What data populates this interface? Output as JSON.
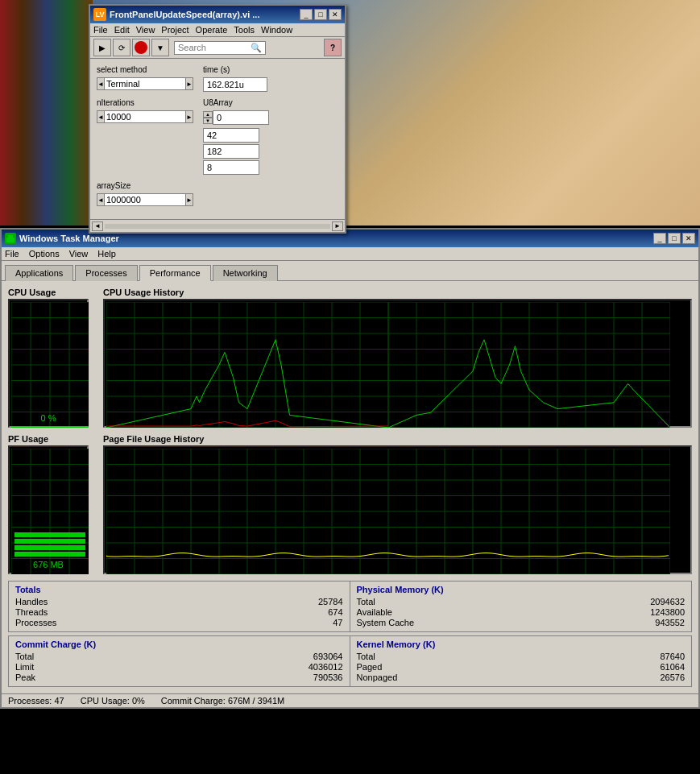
{
  "labview": {
    "title": "FrontPanelUpdateSpeed(array).vi ...",
    "menubar": [
      "File",
      "Edit",
      "View",
      "Project",
      "Operate",
      "Tools",
      "Window"
    ],
    "search_placeholder": "Search",
    "fields": {
      "select_method_label": "select method",
      "select_method_value": "Terminal",
      "time_label": "time (s)",
      "time_value": "162.821u",
      "niterations_label": "nIterations",
      "niterations_value": "10000",
      "arraysize_label": "arraySize",
      "arraysize_value": "1000000",
      "u8array_label": "U8Array",
      "spinner_value": "0",
      "u8array_values": [
        "42",
        "182",
        "8"
      ]
    }
  },
  "taskmanager": {
    "title": "Windows Task Manager",
    "menubar": [
      "File",
      "Options",
      "View",
      "Help"
    ],
    "tabs": [
      "Applications",
      "Processes",
      "Performance",
      "Networking"
    ],
    "active_tab": "Performance",
    "performance": {
      "cpu_usage_label": "CPU Usage",
      "cpu_usage_percent": "0 %",
      "cpu_history_label": "CPU Usage History",
      "pf_usage_label": "PF Usage",
      "pf_usage_value": "676 MB",
      "pf_history_label": "Page File Usage History"
    },
    "totals": {
      "title": "Totals",
      "handles_label": "Handles",
      "handles_value": "25784",
      "threads_label": "Threads",
      "threads_value": "674",
      "processes_label": "Processes",
      "processes_value": "47"
    },
    "physical_memory": {
      "title": "Physical Memory (K)",
      "total_label": "Total",
      "total_value": "2094632",
      "available_label": "Available",
      "available_value": "1243800",
      "system_cache_label": "System Cache",
      "system_cache_value": "943552"
    },
    "commit_charge": {
      "title": "Commit Charge (K)",
      "total_label": "Total",
      "total_value": "693064",
      "limit_label": "Limit",
      "limit_value": "4036012",
      "peak_label": "Peak",
      "peak_value": "790536"
    },
    "kernel_memory": {
      "title": "Kernel Memory (K)",
      "total_label": "Total",
      "total_value": "87640",
      "paged_label": "Paged",
      "paged_value": "61064",
      "nonpaged_label": "Nonpaged",
      "nonpaged_value": "26576"
    },
    "statusbar": {
      "processes": "Processes: 47",
      "cpu": "CPU Usage: 0%",
      "commit": "Commit Charge: 676M / 3941M"
    }
  }
}
